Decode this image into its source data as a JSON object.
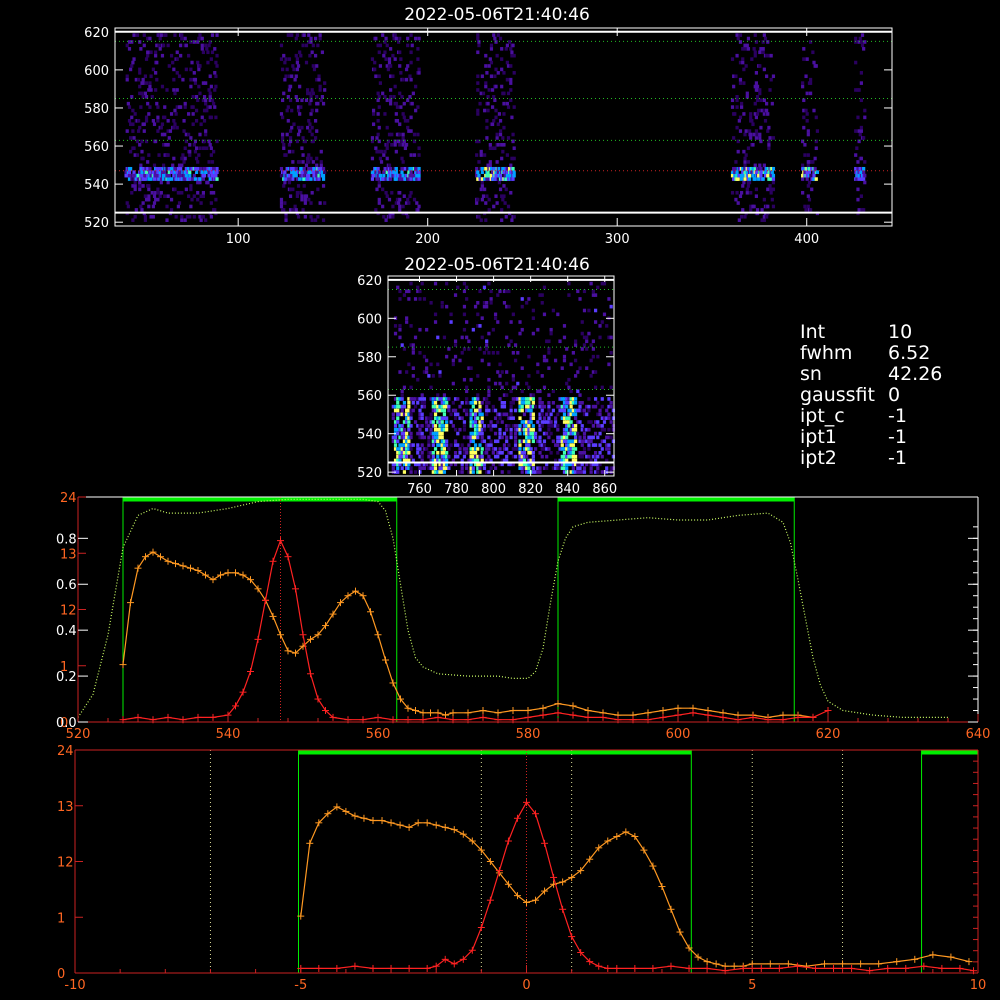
{
  "chart_data": [
    {
      "type": "heatmap",
      "title": "2022-05-06T21:40:46",
      "xlim": [
        35,
        445
      ],
      "ylim": [
        518,
        622
      ],
      "x_ticks": [
        100,
        200,
        300,
        400
      ],
      "y_ticks": [
        520,
        540,
        560,
        580,
        600,
        620
      ],
      "guide_lines_y": [
        {
          "y": 620,
          "color": "#ffffff",
          "style": "solid"
        },
        {
          "y": 525,
          "color": "#ffffff",
          "style": "solid"
        },
        {
          "y": 615,
          "color": "#22bb22",
          "style": "dotted"
        },
        {
          "y": 585,
          "color": "#22bb22",
          "style": "dotted"
        },
        {
          "y": 563,
          "color": "#22bb22",
          "style": "dotted"
        },
        {
          "y": 547,
          "color": "#cc2222",
          "style": "dotted"
        }
      ],
      "bright_row": 546,
      "clusters": [
        [
          40,
          88
        ],
        [
          122,
          145
        ],
        [
          170,
          195
        ],
        [
          225,
          245
        ],
        [
          360,
          382
        ],
        [
          397,
          405
        ],
        [
          425,
          430
        ]
      ],
      "colorscale": [
        "#2a0060",
        "#4a10a0",
        "#5a3cff",
        "#00a0ff",
        "#40ffb0",
        "#ffff60"
      ]
    },
    {
      "type": "heatmap",
      "title": "2022-05-06T21:40:46",
      "xlim": [
        743,
        865
      ],
      "ylim": [
        518,
        622
      ],
      "x_ticks": [
        760,
        780,
        800,
        820,
        840,
        860
      ],
      "y_ticks": [
        520,
        540,
        560,
        580,
        600,
        620
      ],
      "guide_lines_y": [
        {
          "y": 620,
          "color": "#ffffff",
          "style": "solid"
        },
        {
          "y": 525,
          "color": "#ffffff",
          "style": "solid"
        },
        {
          "y": 615,
          "color": "#22bb22",
          "style": "dotted"
        },
        {
          "y": 585,
          "color": "#22bb22",
          "style": "dotted"
        },
        {
          "y": 563,
          "color": "#22bb22",
          "style": "dotted"
        }
      ],
      "bright_columns": [
        750,
        770,
        790,
        817,
        840
      ],
      "colorscale": [
        "#2a0060",
        "#4a10a0",
        "#5a3cff",
        "#00a0ff",
        "#40ffb0",
        "#ffff60"
      ]
    },
    {
      "type": "line",
      "xlim": [
        520,
        640
      ],
      "ylim": [
        0,
        0.98
      ],
      "x_ticks": [
        520,
        540,
        560,
        580,
        600,
        620,
        640
      ],
      "y_ticks_left_white": [
        0.0,
        0.2,
        0.4,
        0.6,
        0.8
      ],
      "y_ticks_left_red": [
        {
          "label": "0",
          "y": 0.0
        },
        {
          "label": "1",
          "y": 0.245
        },
        {
          "label": "12",
          "y": 0.49
        },
        {
          "label": "13",
          "y": 0.735
        },
        {
          "label": "24",
          "y": 0.98
        }
      ],
      "filter_windows": [
        [
          526,
          562.5
        ],
        [
          584,
          615.5
        ]
      ],
      "red_marker_x": 547,
      "series": [
        {
          "color": "#ff9922",
          "x": [
            526,
            527,
            528,
            529,
            530,
            531,
            532,
            533,
            534,
            535,
            536,
            537,
            538,
            539,
            540,
            541,
            542,
            543,
            544,
            545,
            546,
            547,
            548,
            549,
            550,
            551,
            552,
            553,
            554,
            555,
            556,
            557,
            558,
            559,
            560,
            561,
            562,
            563,
            564,
            565,
            566,
            567,
            568,
            569,
            570,
            572,
            574,
            576,
            578,
            580,
            582,
            584,
            586,
            588,
            590,
            592,
            594,
            596,
            598,
            600,
            602,
            604,
            606,
            608,
            610,
            612,
            614,
            616,
            618
          ],
          "y": [
            0.25,
            0.52,
            0.67,
            0.72,
            0.74,
            0.72,
            0.7,
            0.69,
            0.68,
            0.67,
            0.66,
            0.64,
            0.62,
            0.64,
            0.65,
            0.65,
            0.64,
            0.62,
            0.58,
            0.53,
            0.46,
            0.38,
            0.31,
            0.3,
            0.33,
            0.36,
            0.38,
            0.42,
            0.47,
            0.52,
            0.55,
            0.57,
            0.55,
            0.48,
            0.38,
            0.27,
            0.17,
            0.1,
            0.06,
            0.05,
            0.04,
            0.04,
            0.04,
            0.03,
            0.04,
            0.04,
            0.05,
            0.04,
            0.05,
            0.05,
            0.06,
            0.08,
            0.07,
            0.05,
            0.04,
            0.03,
            0.03,
            0.04,
            0.05,
            0.06,
            0.06,
            0.05,
            0.04,
            0.03,
            0.03,
            0.02,
            0.03,
            0.03,
            0.02
          ]
        },
        {
          "color": "#ff2222",
          "x": [
            526,
            528,
            530,
            532,
            534,
            536,
            538,
            540,
            541,
            542,
            543,
            544,
            545,
            546,
            547,
            548,
            549,
            550,
            551,
            552,
            553,
            554,
            556,
            558,
            560,
            562,
            564,
            566,
            568,
            570,
            572,
            574,
            576,
            578,
            580,
            582,
            584,
            586,
            588,
            590,
            592,
            594,
            596,
            598,
            600,
            602,
            604,
            606,
            608,
            610,
            612,
            614,
            616,
            618,
            620
          ],
          "y": [
            0.01,
            0.02,
            0.01,
            0.02,
            0.01,
            0.02,
            0.02,
            0.03,
            0.07,
            0.13,
            0.22,
            0.36,
            0.53,
            0.7,
            0.79,
            0.72,
            0.58,
            0.38,
            0.21,
            0.1,
            0.05,
            0.02,
            0.01,
            0.01,
            0.02,
            0.01,
            0.01,
            0.01,
            0.02,
            0.01,
            0.01,
            0.02,
            0.01,
            0.01,
            0.02,
            0.03,
            0.04,
            0.03,
            0.02,
            0.02,
            0.01,
            0.01,
            0.01,
            0.02,
            0.03,
            0.04,
            0.03,
            0.02,
            0.01,
            0.02,
            0.01,
            0.01,
            0.02,
            0.02,
            0.05
          ]
        },
        {
          "color": "#ccff66",
          "style": "dotted",
          "x": [
            520,
            522,
            524,
            526,
            528,
            530,
            532,
            536,
            540,
            544,
            548,
            552,
            556,
            558,
            560,
            561,
            562,
            563,
            564,
            565,
            566,
            568,
            572,
            576,
            578,
            580,
            581,
            582,
            583,
            584,
            585,
            586,
            588,
            592,
            596,
            600,
            604,
            608,
            612,
            614,
            615,
            616,
            617,
            618,
            619,
            620,
            622,
            626,
            630,
            634,
            636
          ],
          "y": [
            0.02,
            0.12,
            0.38,
            0.76,
            0.9,
            0.93,
            0.91,
            0.91,
            0.93,
            0.96,
            0.97,
            0.97,
            0.97,
            0.97,
            0.96,
            0.92,
            0.8,
            0.6,
            0.4,
            0.28,
            0.24,
            0.21,
            0.2,
            0.2,
            0.19,
            0.19,
            0.22,
            0.32,
            0.52,
            0.7,
            0.8,
            0.85,
            0.87,
            0.88,
            0.89,
            0.88,
            0.88,
            0.9,
            0.91,
            0.87,
            0.78,
            0.62,
            0.45,
            0.28,
            0.16,
            0.09,
            0.05,
            0.03,
            0.02,
            0.02,
            0.02
          ]
        }
      ]
    },
    {
      "type": "line",
      "xlim": [
        -10,
        10
      ],
      "ylim": [
        0,
        0.98
      ],
      "x_ticks": [
        -10,
        -5,
        0,
        5,
        10
      ],
      "y_ticks_left_red": [
        {
          "label": "0",
          "y": 0.0
        },
        {
          "label": "1",
          "y": 0.245
        },
        {
          "label": "12",
          "y": 0.49
        },
        {
          "label": "13",
          "y": 0.735
        },
        {
          "label": "24",
          "y": 0.98
        }
      ],
      "filter_windows": [
        [
          -5.05,
          3.65
        ],
        [
          8.75,
          10
        ]
      ],
      "dotted_vlines": [
        -7,
        -1,
        1,
        5,
        7
      ],
      "red_marker_x": 0,
      "series": [
        {
          "color": "#ff9922",
          "x": [
            -5.0,
            -4.8,
            -4.6,
            -4.4,
            -4.2,
            -4.0,
            -3.8,
            -3.6,
            -3.4,
            -3.2,
            -3.0,
            -2.8,
            -2.6,
            -2.4,
            -2.2,
            -2.0,
            -1.8,
            -1.6,
            -1.4,
            -1.2,
            -1.0,
            -0.8,
            -0.6,
            -0.4,
            -0.2,
            0.0,
            0.2,
            0.4,
            0.6,
            0.8,
            1.0,
            1.2,
            1.4,
            1.6,
            1.8,
            2.0,
            2.2,
            2.4,
            2.6,
            2.8,
            3.0,
            3.2,
            3.4,
            3.6,
            3.8,
            4.0,
            4.2,
            4.4,
            4.6,
            4.8,
            5.0,
            5.4,
            5.8,
            6.2,
            6.6,
            7.0,
            7.4,
            7.8,
            8.2,
            8.6,
            9.0,
            9.4,
            9.8
          ],
          "y": [
            0.25,
            0.57,
            0.66,
            0.7,
            0.73,
            0.71,
            0.69,
            0.68,
            0.67,
            0.67,
            0.66,
            0.65,
            0.64,
            0.66,
            0.66,
            0.65,
            0.64,
            0.63,
            0.61,
            0.58,
            0.54,
            0.49,
            0.44,
            0.39,
            0.34,
            0.31,
            0.32,
            0.36,
            0.39,
            0.4,
            0.42,
            0.45,
            0.5,
            0.55,
            0.58,
            0.6,
            0.62,
            0.6,
            0.54,
            0.47,
            0.38,
            0.28,
            0.18,
            0.11,
            0.07,
            0.05,
            0.04,
            0.03,
            0.03,
            0.03,
            0.04,
            0.04,
            0.04,
            0.03,
            0.04,
            0.04,
            0.04,
            0.04,
            0.05,
            0.06,
            0.08,
            0.07,
            0.05
          ]
        },
        {
          "color": "#ff2222",
          "x": [
            -5.0,
            -4.6,
            -4.2,
            -3.8,
            -3.4,
            -3.0,
            -2.6,
            -2.2,
            -2.0,
            -1.8,
            -1.6,
            -1.4,
            -1.2,
            -1.0,
            -0.8,
            -0.6,
            -0.4,
            -0.2,
            0.0,
            0.2,
            0.4,
            0.6,
            0.8,
            1.0,
            1.2,
            1.4,
            1.6,
            1.8,
            2.0,
            2.4,
            2.8,
            3.2,
            3.6,
            4.0,
            4.4,
            4.8,
            5.2,
            5.6,
            6.0,
            6.4,
            6.8,
            7.2,
            7.6,
            8.0,
            8.4,
            8.8,
            9.2,
            9.6,
            9.9
          ],
          "y": [
            0.02,
            0.02,
            0.02,
            0.03,
            0.02,
            0.02,
            0.02,
            0.02,
            0.03,
            0.06,
            0.04,
            0.06,
            0.1,
            0.2,
            0.32,
            0.45,
            0.58,
            0.68,
            0.75,
            0.7,
            0.57,
            0.42,
            0.28,
            0.16,
            0.09,
            0.05,
            0.03,
            0.02,
            0.02,
            0.02,
            0.02,
            0.03,
            0.02,
            0.02,
            0.01,
            0.02,
            0.02,
            0.02,
            0.03,
            0.02,
            0.02,
            0.02,
            0.01,
            0.02,
            0.02,
            0.03,
            0.02,
            0.02,
            0.01
          ]
        }
      ]
    }
  ],
  "info_panel": [
    {
      "key": "Int",
      "value": "10"
    },
    {
      "key": "fwhm",
      "value": "6.52"
    },
    {
      "key": "sn",
      "value": "42.26"
    },
    {
      "key": "gaussfit",
      "value": "0"
    },
    {
      "key": "ipt_c",
      "value": "-1"
    },
    {
      "key": "ipt1",
      "value": "-1"
    },
    {
      "key": "ipt2",
      "value": "-1"
    }
  ],
  "colors": {
    "axis_white": "#ffffff",
    "axis_red": "#cc2222",
    "window_green": "#00ee00",
    "tick_label_orange": "#ff6622"
  }
}
